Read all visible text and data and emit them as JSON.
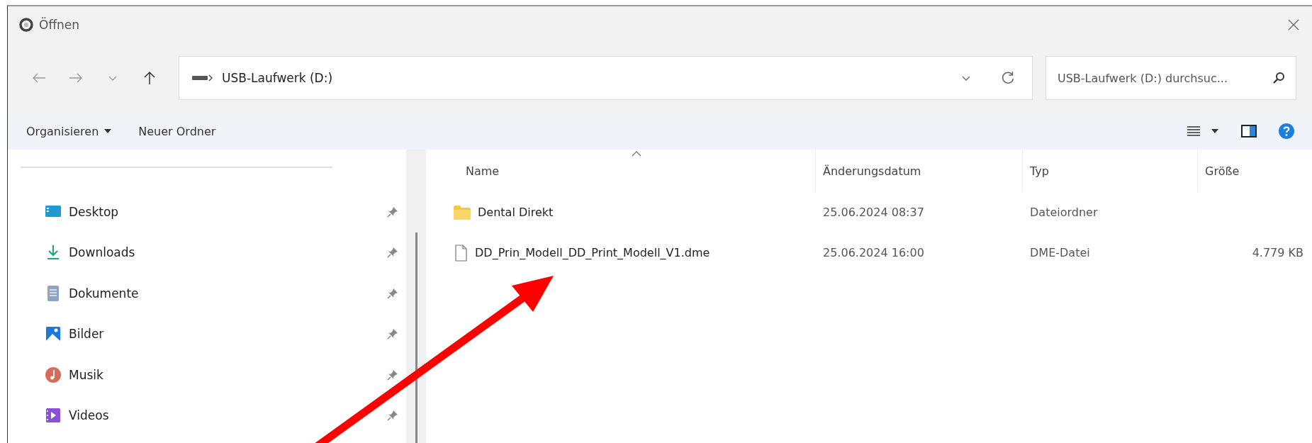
{
  "window": {
    "title": "Öffnen"
  },
  "address_bar": {
    "path": "USB-Laufwerk (D:)"
  },
  "search": {
    "placeholder": "USB-Laufwerk (D:) durchsuc..."
  },
  "toolbar": {
    "buttons": [
      {
        "label": "Organisieren",
        "kind": "menu"
      },
      {
        "label": "Neuer Ordner",
        "kind": "plain"
      }
    ]
  },
  "sidebar": {
    "items": [
      {
        "label": "Desktop",
        "kind": "desktop",
        "pinned": true
      },
      {
        "label": "Downloads",
        "kind": "downloads",
        "pinned": true
      },
      {
        "label": "Dokumente",
        "kind": "documents",
        "pinned": true
      },
      {
        "label": "Bilder",
        "kind": "pictures",
        "pinned": true
      },
      {
        "label": "Musik",
        "kind": "music",
        "pinned": true
      },
      {
        "label": "Videos",
        "kind": "videos",
        "pinned": true
      }
    ]
  },
  "file_list": {
    "columns": [
      {
        "label": "Name",
        "sorted": true
      },
      {
        "label": "Änderungsdatum",
        "sorted": false
      },
      {
        "label": "Typ",
        "sorted": false
      },
      {
        "label": "Größe",
        "sorted": false
      }
    ],
    "rows": [
      {
        "kind": "folder",
        "name": "Dental Direkt",
        "modified": "25.06.2024 08:37",
        "type": "Dateiordner"
      },
      {
        "kind": "file",
        "name": "DD_Prin_Modell_DD_Print_Modell_V1.dme",
        "modified": "25.06.2024 16:00",
        "type": "DME-Datei",
        "size": "4.779 KB"
      }
    ]
  }
}
